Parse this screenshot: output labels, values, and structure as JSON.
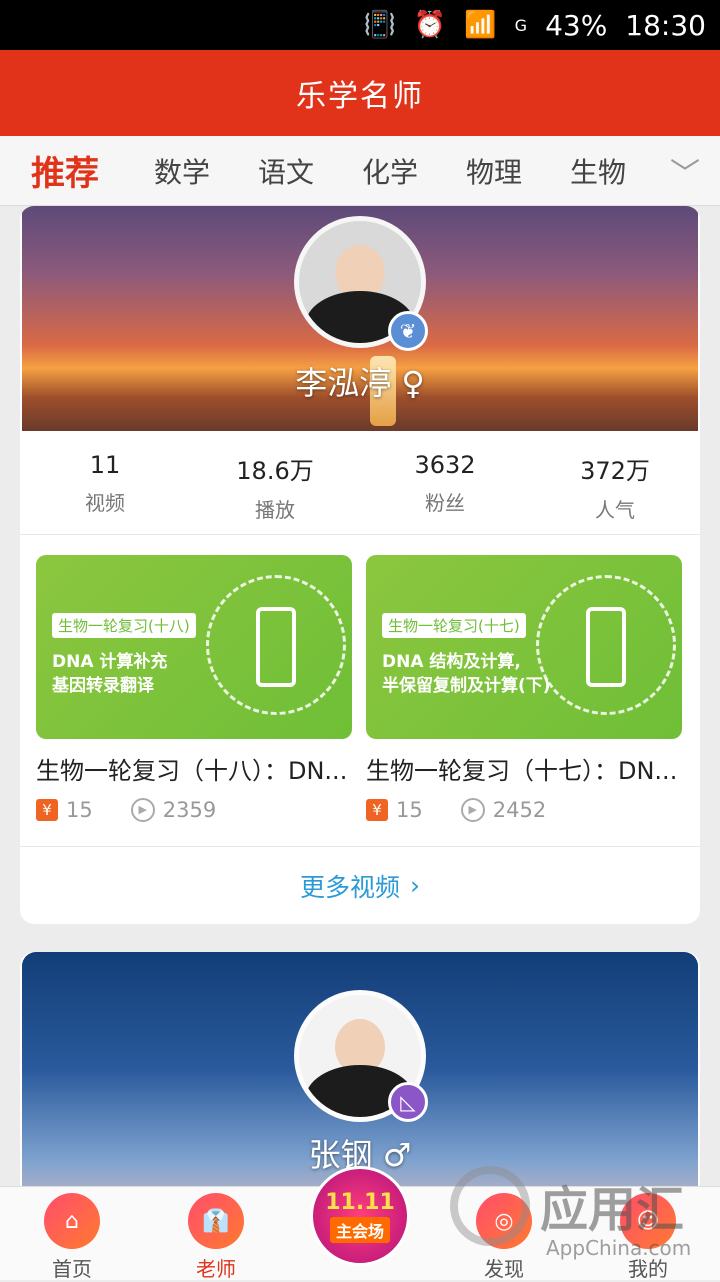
{
  "status_bar": {
    "battery": "43%",
    "time": "18:30",
    "signal": "G"
  },
  "app": {
    "title": "乐学名师"
  },
  "tabs": [
    {
      "label": "推荐"
    },
    {
      "label": "数学"
    },
    {
      "label": "语文"
    },
    {
      "label": "化学"
    },
    {
      "label": "物理"
    },
    {
      "label": "生物"
    }
  ],
  "teacher1": {
    "name": "李泓渟 ♀",
    "stats": [
      {
        "value": "11",
        "label": "视频"
      },
      {
        "value": "18.6万",
        "label": "播放"
      },
      {
        "value": "3632",
        "label": "粉丝"
      },
      {
        "value": "372万",
        "label": "人气"
      }
    ],
    "videos": [
      {
        "tag": "生物一轮复习(十八)",
        "line1": "DNA 计算补充",
        "line2": "基因转录翻译",
        "title": "生物一轮复习（十八）：DN...",
        "price": "15",
        "plays": "2359"
      },
      {
        "tag": "生物一轮复习(十七)",
        "line1": "DNA 结构及计算,",
        "line2": "半保留复制及计算(下)",
        "title": "生物一轮复习（十七）：DN...",
        "price": "15",
        "plays": "2452"
      }
    ],
    "more_label": "更多视频"
  },
  "teacher2": {
    "name": "张钢 ♂"
  },
  "bottom_nav": [
    {
      "label": "首页"
    },
    {
      "label": "老师"
    },
    {
      "label": "发现"
    },
    {
      "label": "我的"
    }
  ],
  "promo": {
    "title": "11.11",
    "subtitle": "主会场"
  },
  "watermark": {
    "text": "应用汇",
    "url": "AppChina.com"
  },
  "colors": {
    "brand": "#e0331a",
    "link": "#2a9ad8",
    "video_bg": "#8cc63f"
  }
}
